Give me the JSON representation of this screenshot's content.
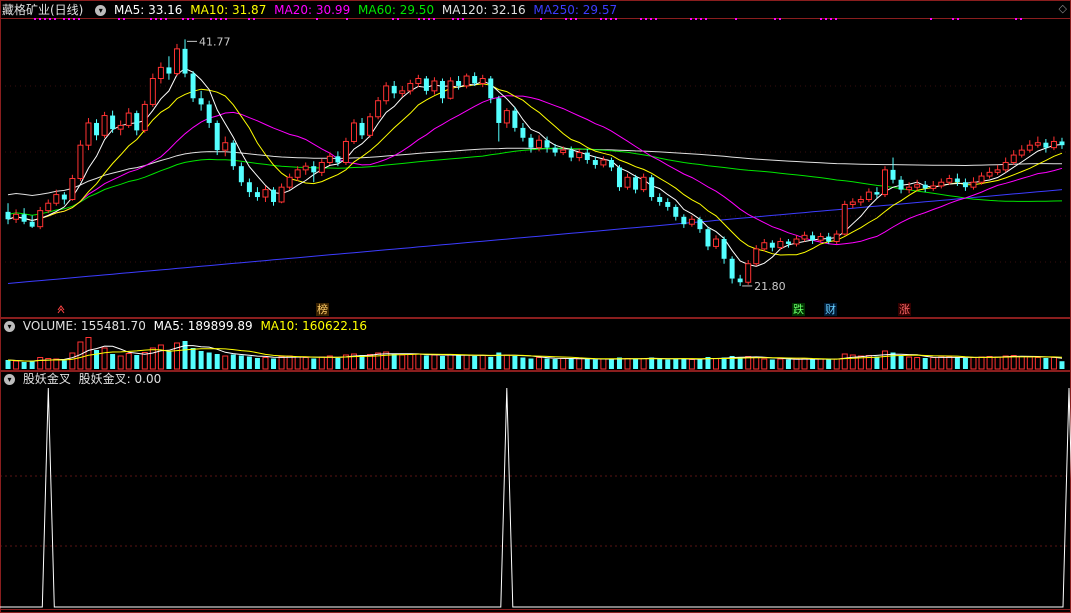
{
  "header": {
    "stock_title": "藏格矿业(日线)",
    "ma5": "MA5: 33.16",
    "ma10": "MA10: 31.87",
    "ma20": "MA20: 30.99",
    "ma60": "MA60: 29.50",
    "ma120": "MA120: 32.16",
    "ma250": "MA250: 29.57"
  },
  "colors": {
    "up": "#ff3232",
    "down": "#54ffff",
    "ma5": "#ffffff",
    "ma10": "#ffff00",
    "ma20": "#ff00ff",
    "ma60": "#00e600",
    "ma120": "#e0e0e0",
    "ma250": "#3c3cff",
    "grid": "#8a1e1e",
    "marker": "#ff00ff"
  },
  "price_chart": {
    "high_label": "41.77",
    "low_label": "21.80"
  },
  "event_flags": [
    {
      "label": "榜",
      "color": "#ffcc66",
      "bg": "#3a2200"
    },
    {
      "label": "跌",
      "color": "#66ff66",
      "bg": "#003300"
    },
    {
      "label": "财",
      "color": "#66ccff",
      "bg": "#001a33"
    },
    {
      "label": "涨",
      "color": "#ff6666",
      "bg": "#330000"
    }
  ],
  "volume_header": {
    "title": "VOLUME: 155481.70",
    "ma5": "MA5: 189899.89",
    "ma10": "MA10: 160622.16"
  },
  "indicator_header": {
    "name": "股妖金叉",
    "value": "股妖金叉: 0.00"
  },
  "chart_data": {
    "type": "candlestick",
    "price_range": [
      20.5,
      43.5
    ],
    "candles": [
      [
        27.8,
        27.2,
        28.5,
        26.8
      ],
      [
        27.2,
        27.6,
        28.0,
        26.9
      ],
      [
        27.6,
        27.0,
        28.1,
        26.8
      ],
      [
        27.0,
        26.6,
        27.5,
        26.5
      ],
      [
        26.6,
        27.9,
        28.2,
        26.4
      ],
      [
        27.9,
        28.5,
        28.8,
        27.7
      ],
      [
        28.5,
        29.2,
        29.6,
        28.3
      ],
      [
        29.2,
        28.8,
        29.4,
        28.4
      ],
      [
        28.8,
        30.5,
        30.8,
        28.7
      ],
      [
        30.5,
        33.2,
        33.6,
        30.3
      ],
      [
        33.2,
        35.0,
        35.4,
        32.8
      ],
      [
        35.0,
        34.0,
        35.3,
        33.6
      ],
      [
        34.0,
        35.6,
        35.9,
        33.8
      ],
      [
        35.6,
        34.5,
        36.0,
        34.2
      ],
      [
        34.5,
        34.8,
        35.2,
        34.0
      ],
      [
        34.8,
        35.8,
        36.2,
        34.6
      ],
      [
        35.8,
        34.4,
        36.0,
        34.0
      ],
      [
        34.4,
        36.5,
        36.8,
        34.2
      ],
      [
        36.5,
        38.6,
        39.0,
        36.3
      ],
      [
        38.6,
        39.5,
        39.9,
        38.2
      ],
      [
        39.5,
        39.0,
        40.4,
        38.5
      ],
      [
        39.0,
        41.0,
        41.4,
        38.8
      ],
      [
        41.0,
        39.0,
        41.77,
        38.7
      ],
      [
        39.0,
        37.0,
        39.2,
        36.7
      ],
      [
        37.0,
        36.5,
        37.6,
        36.0
      ],
      [
        36.5,
        35.0,
        36.8,
        34.6
      ],
      [
        35.0,
        32.8,
        35.2,
        32.4
      ],
      [
        32.8,
        33.4,
        33.9,
        32.3
      ],
      [
        33.4,
        31.5,
        33.6,
        31.2
      ],
      [
        31.5,
        30.2,
        31.8,
        29.9
      ],
      [
        30.2,
        29.4,
        30.5,
        29.0
      ],
      [
        29.4,
        29.0,
        29.8,
        28.7
      ],
      [
        29.0,
        29.6,
        29.9,
        28.6
      ],
      [
        29.6,
        28.6,
        29.8,
        28.3
      ],
      [
        28.6,
        29.8,
        30.1,
        28.5
      ],
      [
        29.8,
        30.6,
        30.9,
        29.6
      ],
      [
        30.6,
        31.2,
        31.5,
        30.3
      ],
      [
        31.2,
        31.5,
        31.8,
        30.8
      ],
      [
        31.5,
        31.0,
        31.9,
        30.2
      ],
      [
        31.0,
        31.8,
        32.1,
        30.7
      ],
      [
        31.8,
        32.3,
        32.6,
        31.6
      ],
      [
        32.3,
        31.8,
        32.7,
        31.5
      ],
      [
        31.8,
        33.5,
        33.8,
        31.6
      ],
      [
        33.5,
        35.0,
        35.3,
        33.3
      ],
      [
        35.0,
        34.0,
        35.4,
        33.7
      ],
      [
        34.0,
        35.5,
        35.8,
        33.8
      ],
      [
        35.5,
        36.8,
        37.1,
        35.3
      ],
      [
        36.8,
        38.0,
        38.3,
        36.5
      ],
      [
        38.0,
        37.4,
        38.4,
        37.0
      ],
      [
        37.4,
        37.6,
        38.0,
        37.1
      ],
      [
        37.6,
        38.2,
        38.5,
        37.3
      ],
      [
        38.2,
        38.6,
        38.9,
        37.9
      ],
      [
        38.6,
        37.6,
        38.8,
        37.3
      ],
      [
        37.6,
        38.4,
        38.7,
        37.3
      ],
      [
        38.4,
        37.0,
        38.6,
        36.6
      ],
      [
        37.0,
        38.4,
        38.7,
        36.9
      ],
      [
        38.4,
        38.0,
        38.8,
        37.7
      ],
      [
        38.0,
        38.8,
        39.0,
        37.8
      ],
      [
        38.8,
        38.2,
        39.1,
        38.0
      ],
      [
        38.2,
        38.6,
        38.9,
        37.9
      ],
      [
        38.6,
        37.0,
        38.8,
        36.6
      ],
      [
        37.0,
        35.0,
        37.2,
        33.5
      ],
      [
        35.0,
        36.0,
        36.2,
        34.6
      ],
      [
        36.0,
        34.6,
        36.3,
        34.3
      ],
      [
        34.6,
        33.8,
        35.0,
        33.5
      ],
      [
        33.8,
        33.0,
        34.1,
        32.6
      ],
      [
        33.0,
        33.6,
        34.0,
        32.7
      ],
      [
        33.6,
        33.0,
        33.9,
        32.6
      ],
      [
        33.0,
        32.6,
        33.3,
        32.3
      ],
      [
        32.6,
        32.8,
        33.1,
        32.4
      ],
      [
        32.8,
        32.2,
        33.1,
        31.9
      ],
      [
        32.2,
        32.6,
        32.9,
        31.9
      ],
      [
        32.6,
        32.0,
        32.9,
        31.7
      ],
      [
        32.0,
        31.6,
        32.3,
        31.3
      ],
      [
        31.6,
        32.0,
        32.3,
        31.4
      ],
      [
        32.0,
        31.4,
        32.2,
        31.1
      ],
      [
        31.4,
        29.8,
        31.6,
        29.5
      ],
      [
        29.8,
        30.6,
        30.9,
        29.6
      ],
      [
        30.6,
        29.6,
        30.8,
        29.3
      ],
      [
        29.6,
        30.6,
        30.9,
        29.4
      ],
      [
        30.6,
        29.0,
        30.8,
        28.7
      ],
      [
        29.0,
        28.6,
        29.3,
        28.3
      ],
      [
        28.6,
        28.2,
        28.9,
        27.9
      ],
      [
        28.2,
        27.4,
        28.4,
        27.1
      ],
      [
        27.4,
        26.8,
        27.6,
        26.5
      ],
      [
        26.8,
        27.2,
        27.5,
        26.6
      ],
      [
        27.2,
        26.4,
        27.4,
        26.1
      ],
      [
        26.4,
        25.0,
        26.6,
        24.7
      ],
      [
        25.0,
        25.6,
        25.9,
        24.8
      ],
      [
        25.6,
        24.0,
        25.8,
        23.6
      ],
      [
        24.0,
        22.4,
        24.2,
        22.0
      ],
      [
        22.4,
        22.1,
        22.7,
        21.8
      ],
      [
        22.1,
        23.6,
        23.9,
        21.9
      ],
      [
        23.6,
        24.8,
        25.1,
        23.4
      ],
      [
        24.8,
        25.3,
        25.6,
        24.6
      ],
      [
        25.3,
        24.9,
        25.5,
        24.6
      ],
      [
        24.9,
        25.4,
        25.7,
        24.7
      ],
      [
        25.4,
        25.2,
        25.6,
        24.9
      ],
      [
        25.2,
        25.6,
        25.9,
        25.0
      ],
      [
        25.6,
        25.9,
        26.2,
        25.4
      ],
      [
        25.9,
        25.5,
        26.2,
        25.2
      ],
      [
        25.5,
        25.8,
        26.1,
        25.3
      ],
      [
        25.8,
        25.4,
        26.1,
        25.2
      ],
      [
        25.4,
        26.0,
        26.3,
        25.2
      ],
      [
        26.0,
        28.4,
        28.7,
        25.9
      ],
      [
        28.4,
        28.6,
        28.9,
        28.1
      ],
      [
        28.6,
        28.8,
        29.1,
        28.3
      ],
      [
        28.8,
        29.4,
        29.7,
        28.6
      ],
      [
        29.4,
        29.2,
        29.8,
        28.9
      ],
      [
        29.2,
        31.2,
        31.5,
        29.0
      ],
      [
        31.2,
        30.4,
        32.2,
        30.1
      ],
      [
        30.4,
        29.6,
        30.7,
        29.3
      ],
      [
        29.6,
        29.8,
        30.2,
        29.3
      ],
      [
        29.8,
        30.0,
        30.4,
        29.5
      ],
      [
        30.0,
        29.7,
        30.3,
        29.4
      ],
      [
        29.7,
        29.9,
        30.3,
        29.5
      ],
      [
        29.9,
        30.2,
        30.5,
        29.7
      ],
      [
        30.2,
        30.5,
        30.8,
        30.0
      ],
      [
        30.5,
        30.2,
        30.9,
        29.9
      ],
      [
        30.2,
        29.8,
        30.5,
        29.5
      ],
      [
        29.8,
        30.2,
        30.6,
        29.6
      ],
      [
        30.2,
        30.7,
        31.0,
        30.0
      ],
      [
        30.7,
        31.0,
        31.4,
        30.5
      ],
      [
        31.0,
        31.2,
        31.6,
        30.8
      ],
      [
        31.2,
        31.8,
        32.2,
        31.0
      ],
      [
        31.8,
        32.4,
        32.8,
        31.6
      ],
      [
        32.4,
        32.8,
        33.2,
        32.2
      ],
      [
        32.8,
        33.2,
        33.6,
        32.6
      ],
      [
        33.2,
        33.4,
        33.9,
        33.0
      ],
      [
        33.4,
        33.0,
        33.7,
        32.6
      ],
      [
        33.0,
        33.5,
        33.9,
        32.8
      ],
      [
        33.5,
        33.2,
        33.8,
        32.9
      ]
    ],
    "ma_series_shown": [
      "MA5",
      "MA10",
      "MA20",
      "MA60",
      "MA120",
      "MA250"
    ],
    "volume_range": [
      0,
      700000
    ],
    "volume": [
      180000,
      160000,
      140000,
      150000,
      230000,
      210000,
      200000,
      170000,
      320000,
      540000,
      630000,
      380000,
      420000,
      300000,
      260000,
      310000,
      280000,
      330000,
      420000,
      480000,
      360000,
      520000,
      560000,
      420000,
      360000,
      330000,
      300000,
      260000,
      290000,
      270000,
      250000,
      220000,
      230000,
      210000,
      250000,
      260000,
      240000,
      230000,
      210000,
      240000,
      260000,
      220000,
      280000,
      300000,
      280000,
      290000,
      320000,
      340000,
      300000,
      280000,
      290000,
      300000,
      270000,
      280000,
      260000,
      290000,
      270000,
      280000,
      260000,
      270000,
      240000,
      330000,
      280000,
      260000,
      230000,
      210000,
      230000,
      210000,
      200000,
      210000,
      200000,
      210000,
      200000,
      190000,
      200000,
      190000,
      230000,
      210000,
      200000,
      210000,
      230000,
      200000,
      190000,
      200000,
      210000,
      190000,
      200000,
      240000,
      210000,
      230000,
      260000,
      240000,
      250000,
      230000,
      200000,
      190000,
      200000,
      190000,
      200000,
      210000,
      190000,
      200000,
      190000,
      200000,
      300000,
      280000,
      260000,
      270000,
      250000,
      360000,
      330000,
      260000,
      240000,
      230000,
      220000,
      230000,
      240000,
      240000,
      230000,
      220000,
      230000,
      240000,
      250000,
      240000,
      260000,
      270000,
      250000,
      240000,
      230000,
      220000,
      230000,
      155481.7
    ],
    "signal_peaks_at_bar_index": [
      5,
      62,
      144
    ]
  },
  "corner_glyph": "◇"
}
